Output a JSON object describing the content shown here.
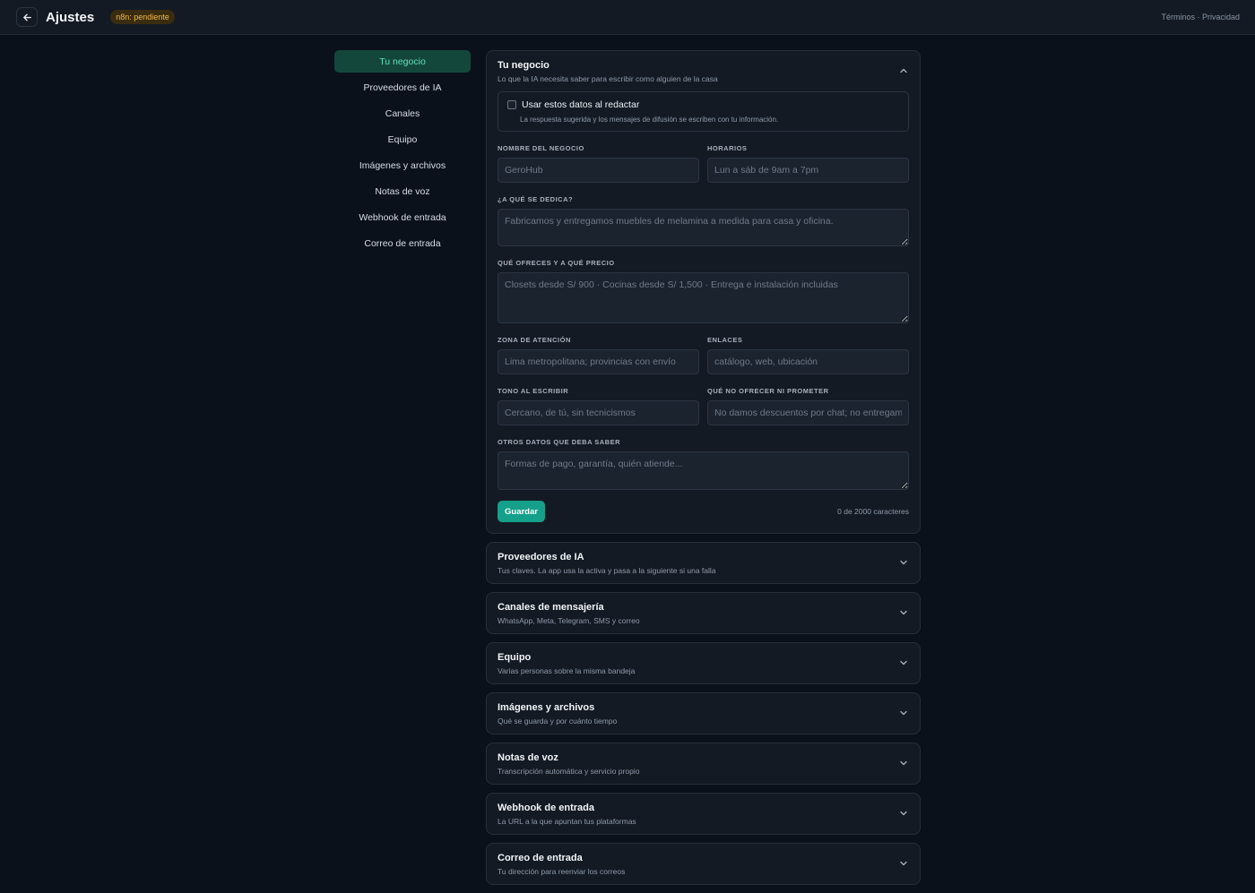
{
  "header": {
    "title": "Ajustes",
    "badge": "n8n: pendiente",
    "links": [
      "Términos",
      "Privacidad"
    ],
    "separator": " · "
  },
  "sidebar": {
    "items": [
      {
        "label": "Tu negocio",
        "active": true
      },
      {
        "label": "Proveedores de IA"
      },
      {
        "label": "Canales"
      },
      {
        "label": "Equipo"
      },
      {
        "label": "Imágenes y archivos"
      },
      {
        "label": "Notas de voz"
      },
      {
        "label": "Webhook de entrada"
      },
      {
        "label": "Correo de entrada"
      }
    ]
  },
  "business": {
    "title": "Tu negocio",
    "subtitle": "Lo que la IA necesita saber para escribir como alguien de la casa",
    "use_data_label": "Usar estos datos al redactar",
    "use_data_desc": "La respuesta sugerida y los mensajes de difusión se escriben con tu información.",
    "fields": {
      "name": {
        "label": "NOMBRE DEL NEGOCIO",
        "placeholder": "GeroHub",
        "value": ""
      },
      "hours": {
        "label": "HORARIOS",
        "placeholder": "Lun a sáb de 9am a 7pm",
        "value": ""
      },
      "about": {
        "label": "¿A QUÉ SE DEDICA?",
        "placeholder": "Fabricamos y entregamos muebles de melamina a medida para casa y oficina.",
        "value": ""
      },
      "offer": {
        "label": "QUÉ OFRECES Y A QUÉ PRECIO",
        "placeholder": "Closets desde S/ 900 · Cocinas desde S/ 1,500 · Entrega e instalación incluidas",
        "value": ""
      },
      "zone": {
        "label": "ZONA DE ATENCIÓN",
        "placeholder": "Lima metropolitana; provincias con envío",
        "value": ""
      },
      "links": {
        "label": "ENLACES",
        "placeholder": "catálogo, web, ubicación",
        "value": ""
      },
      "tone": {
        "label": "TONO AL ESCRIBIR",
        "placeholder": "Cercano, de tú, sin tecnicismos",
        "value": ""
      },
      "avoid": {
        "label": "QUÉ NO OFRECER NI PROMETER",
        "placeholder": "No damos descuentos por chat; no entregamos",
        "value": ""
      },
      "other": {
        "label": "OTROS DATOS QUE DEBA SABER",
        "placeholder": "Formas de pago, garantía, quién atiende...",
        "value": ""
      }
    },
    "save_label": "Guardar",
    "counter": "0 de 2000 caracteres"
  },
  "sections": [
    {
      "title": "Proveedores de IA",
      "subtitle": "Tus claves. La app usa la activa y pasa a la siguiente si una falla"
    },
    {
      "title": "Canales de mensajería",
      "subtitle": "WhatsApp, Meta, Telegram, SMS y correo"
    },
    {
      "title": "Equipo",
      "subtitle": "Varias personas sobre la misma bandeja"
    },
    {
      "title": "Imágenes y archivos",
      "subtitle": "Qué se guarda y por cuánto tiempo"
    },
    {
      "title": "Notas de voz",
      "subtitle": "Transcripción automática y servicio propio"
    },
    {
      "title": "Webhook de entrada",
      "subtitle": "La URL a la que apuntan tus plataformas"
    },
    {
      "title": "Correo de entrada",
      "subtitle": "Tu dirección para reenviar los correos"
    }
  ],
  "colors": {
    "accent": "#14a08a",
    "active_bg": "#14473c",
    "active_text": "#5fe0b8",
    "badge_text": "#f2b94a"
  }
}
